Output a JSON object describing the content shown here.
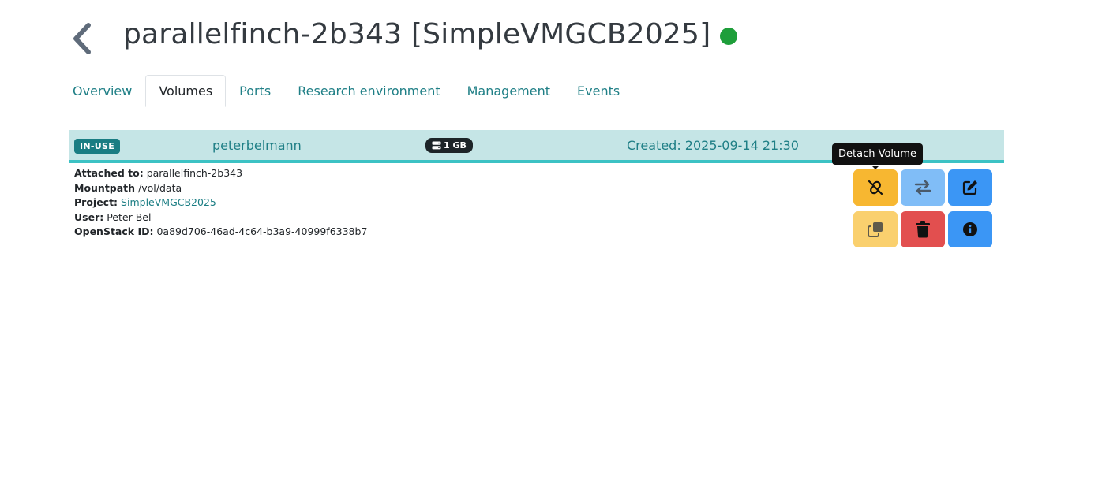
{
  "header": {
    "title": "parallelfinch-2b343 [SimpleVMGCB2025]",
    "status_color": "#1e9e3a",
    "back_icon": "chevron-left-icon"
  },
  "tabs": [
    {
      "label": "Overview",
      "active": false
    },
    {
      "label": "Volumes",
      "active": true
    },
    {
      "label": "Ports",
      "active": false
    },
    {
      "label": "Research environment",
      "active": false
    },
    {
      "label": "Management",
      "active": false
    },
    {
      "label": "Events",
      "active": false
    }
  ],
  "volume": {
    "status": "IN-USE",
    "owner": "peterbelmann",
    "size": "1 GB",
    "size_icon": "storage-icon",
    "created": "Created: 2025-09-14 21:30",
    "details": {
      "attached_label": "Attached to:",
      "attached_value": "parallelfinch-2b343",
      "mountpath_label": "Mountpath",
      "mountpath_value": "/vol/data",
      "project_label": "Project:",
      "project_value": "SimpleVMGCB2025",
      "user_label": "User:",
      "user_value": "Peter Bel",
      "openstack_label": "OpenStack ID:",
      "openstack_value": "0a89d706-46ad-4c64-b3a9-40999f6338b7"
    },
    "tooltip": "Detach Volume",
    "actions": [
      {
        "name": "detach",
        "icon": "unlink-icon",
        "color": "#f7b731"
      },
      {
        "name": "transfer",
        "icon": "arrows-exchange-icon",
        "color": "#80bdf7"
      },
      {
        "name": "edit",
        "icon": "edit-icon",
        "color": "#3b96f5"
      },
      {
        "name": "copy",
        "icon": "copy-icon",
        "color": "#fad06e"
      },
      {
        "name": "delete",
        "icon": "trash-icon",
        "color": "#e24f4f"
      },
      {
        "name": "info",
        "icon": "info-icon",
        "color": "#3b96f5"
      }
    ]
  }
}
